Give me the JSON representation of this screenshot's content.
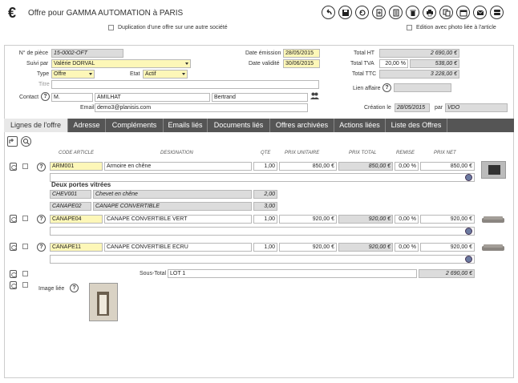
{
  "header": {
    "title": "Offre pour GAMMA AUTOMATION à PARIS",
    "euro_symbol": "€",
    "dup_label": "Duplication d'une offre sur une autre société",
    "photo_label": "Edition avec photo liée à l'article"
  },
  "toolbar": [
    "back-icon",
    "save-icon",
    "refresh-icon",
    "new-doc-icon",
    "copy-icon",
    "trash-icon",
    "print-icon",
    "duplicate-icon",
    "calendar-icon",
    "email-icon",
    "database-icon",
    "export-icon"
  ],
  "form": {
    "piece_label": "N° de pièce",
    "piece_value": "15-0002-OFT",
    "suivi_label": "Suivi par",
    "suivi_value": "Valérie DORVAL",
    "type_label": "Type",
    "type_value": "Offre",
    "etat_label": "Etat",
    "etat_value": "Actif",
    "titre_label": "Titre",
    "titre_value": "",
    "contact_label": "Contact",
    "civ": "M.",
    "nom": "AMILHAT",
    "prenom": "Bertrand",
    "email_label": "Email",
    "email_value": "demo3@planisis.com",
    "date_emission_label": "Date émission",
    "date_emission": "28/05/2015",
    "date_validite_label": "Date validité",
    "date_validite": "30/06/2015",
    "total_ht_label": "Total HT",
    "total_ht": "2 690,00 €",
    "total_tva_label": "Total TVA",
    "tva_rate": "20,00 %",
    "total_tva": "538,00 €",
    "total_ttc_label": "Total TTC",
    "total_ttc": "3 228,00 €",
    "lien_label": "Lien affaire",
    "creation_label": "Création le",
    "creation_date": "28/05/2015",
    "par_label": "par",
    "par_value": "VDO"
  },
  "tabs": [
    "Lignes de l'offre",
    "Adresse",
    "Compléments",
    "Emails liés",
    "Documents liés",
    "Offres archivées",
    "Actions liées",
    "Liste des Offres"
  ],
  "columns": {
    "code": "CODE ARTICLE",
    "designation": "DESIGNATION",
    "qte": "QTE",
    "pu": "PRIX UNITAIRE",
    "pt": "PRIX TOTAL",
    "remise": "REMISE",
    "pn": "PRIX NET"
  },
  "lines": [
    {
      "code": "ARM001",
      "designation": "Armoire en chêne",
      "qte": "1,00",
      "pu": "850,00 €",
      "pt": "850,00 €",
      "remise": "0,00 %",
      "pn": "850,00 €",
      "note": "Deux portes vitrées",
      "sub": [
        {
          "code": "CHEV001",
          "designation": "Chevet en chêne",
          "qte": "2,00"
        },
        {
          "code": "CANAPE02",
          "designation": "CANAPE CONVERTIBLE",
          "qte": "3,00"
        }
      ]
    },
    {
      "code": "CANAPE04",
      "designation": "CANAPE CONVERTIBLE VERT",
      "qte": "1,00",
      "pu": "920,00 €",
      "pt": "920,00 €",
      "remise": "0,00 %",
      "pn": "920,00 €"
    },
    {
      "code": "CANAPE11",
      "designation": "CANAPE CONVERTIBLE ECRU",
      "qte": "1,00",
      "pu": "920,00 €",
      "pt": "920,00 €",
      "remise": "0,00 %",
      "pn": "920,00 €"
    }
  ],
  "subtotal": {
    "label": "Sous-Total",
    "name": "LOT 1",
    "value": "2 690,00 €"
  },
  "image_label": "Image liée",
  "colors": {
    "yellow": "#fdf7b8",
    "grey": "#dcdcdc",
    "tabbar": "#555555"
  }
}
